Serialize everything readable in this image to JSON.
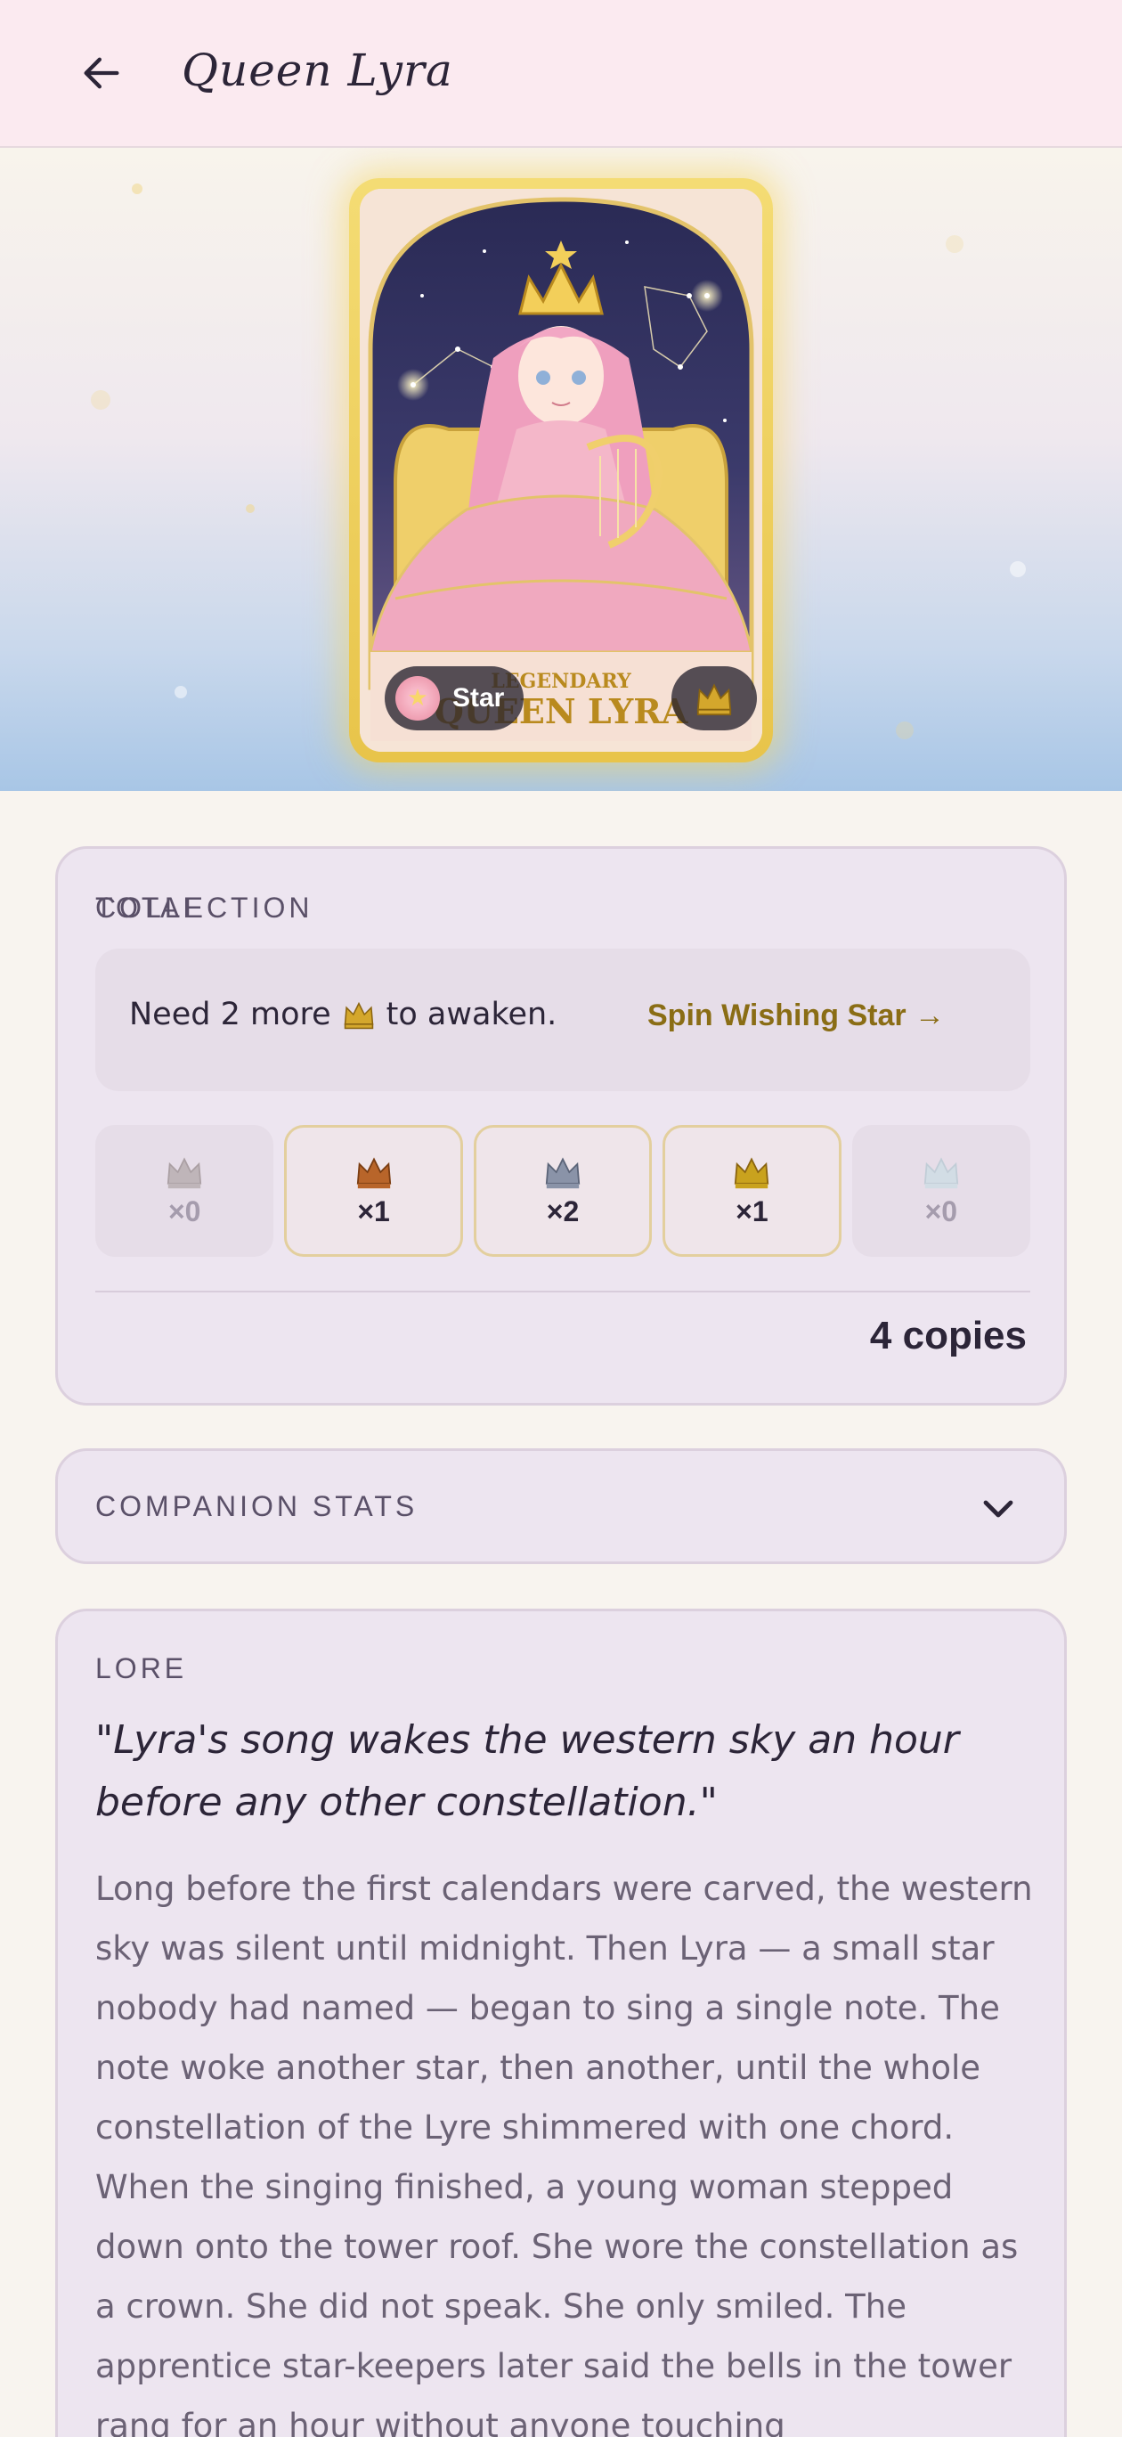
{
  "header": {
    "title": "Queen Lyra",
    "back_icon": "arrow-left-icon"
  },
  "hero": {
    "card_art_text": [
      "LEGENDARY",
      "QUEEN LYRA"
    ],
    "chip_label": "Star",
    "chip_icon": "star-icon",
    "badge_icon": "gold-crown-icon"
  },
  "collection": {
    "label": "COLLECTION",
    "awaken_prefix": "Need 2 more",
    "awaken_suffix": "to awaken.",
    "awaken_icon": "gold-crown-icon",
    "action_label": "Spin Wishing Star →",
    "tiers": [
      {
        "count": "×0",
        "icon": "silver-crown-icon",
        "color": "#a69b9b",
        "owned": false
      },
      {
        "count": "×1",
        "icon": "bronze-crown-icon",
        "color": "#b8652a",
        "owned": true
      },
      {
        "count": "×2",
        "icon": "steel-crown-icon",
        "color": "#8a93a8",
        "owned": true
      },
      {
        "count": "×1",
        "icon": "gold-crown-icon",
        "color": "#c9a21e",
        "owned": true
      },
      {
        "count": "×0",
        "icon": "diamond-crown-icon",
        "color": "#c6dde4",
        "owned": false
      }
    ],
    "total_label": "TOTAL",
    "total_value": "4 copies"
  },
  "stats": {
    "label": "COMPANION STATS",
    "toggle_icon": "chevron-down-icon"
  },
  "lore": {
    "label": "LORE",
    "quote": "\"Lyra's song wakes the western sky an hour before any other constellation.\"",
    "body": "Long before the first calendars were carved, the western sky was silent until midnight. Then Lyra — a small star nobody had named — began to sing a single note. The note woke another star, then another, until the whole constellation of the Lyre shimmered with one chord. When the singing finished, a young woman stepped down onto the tower roof. She wore the constellation as a crown. She did not speak. She only smiled. The apprentice star-keepers later said the bells in the tower rang for an hour without anyone touching"
  },
  "colors": {
    "header_bg": "#fbeaf0",
    "panel_bg": "#ede5f0",
    "accent_gold": "#8a6d15",
    "text_dark": "#2c2538",
    "text_muted": "#6b6275"
  }
}
